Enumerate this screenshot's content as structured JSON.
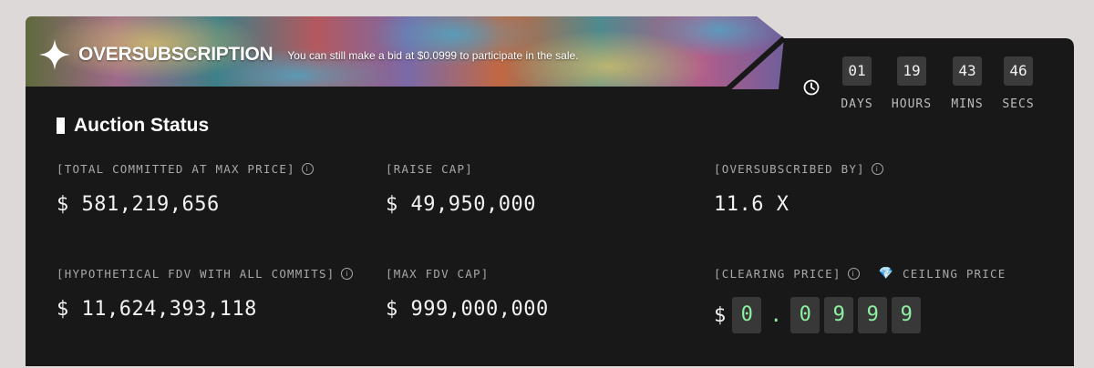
{
  "banner": {
    "title": "OVERSUBSCRIPTION",
    "subtitle": "You can still make a bid at $0.0999 to participate in the sale."
  },
  "countdown": {
    "icon": "clock-icon",
    "units": [
      {
        "value": "01",
        "label": "DAYS"
      },
      {
        "value": "19",
        "label": "HOURS"
      },
      {
        "value": "43",
        "label": "MINS"
      },
      {
        "value": "46",
        "label": "SECS"
      }
    ]
  },
  "section_title": "Auction Status",
  "stats": {
    "total_committed": {
      "label": "[TOTAL COMMITTED AT MAX PRICE]",
      "value": "$ 581,219,656"
    },
    "raise_cap": {
      "label": "[RAISE CAP]",
      "value": "$ 49,950,000"
    },
    "oversubscribed": {
      "label": "[OVERSUBSCRIBED BY]",
      "value": "11.6 X"
    },
    "hypothetical_fdv": {
      "label": "[HYPOTHETICAL FDV WITH ALL COMMITS]",
      "value": "$ 11,624,393,118"
    },
    "max_fdv_cap": {
      "label": "[MAX FDV CAP]",
      "value": "$ 999,000,000"
    },
    "clearing_price": {
      "label": "[CLEARING PRICE]",
      "ceiling_label": "CEILING PRICE",
      "symbol": "$",
      "digits": [
        "0",
        ".",
        "0",
        "9",
        "9",
        "9"
      ]
    }
  },
  "colors": {
    "card": "#181818",
    "digit_green": "#8ef0a2",
    "label_gray": "#a8a8a8",
    "gem_blue": "#5bc8f5"
  }
}
